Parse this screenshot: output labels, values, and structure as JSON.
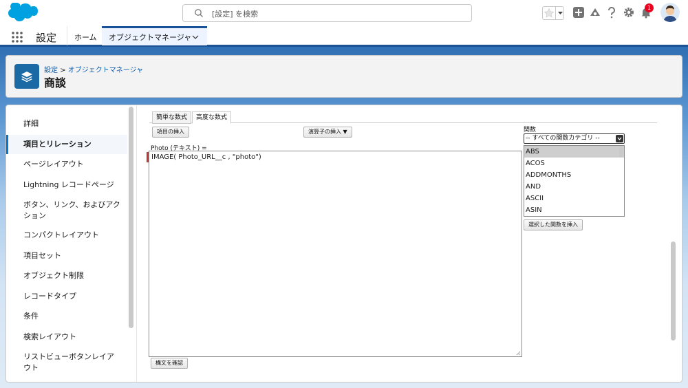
{
  "header": {
    "search_placeholder": "[設定] を検索",
    "notification_count": "1"
  },
  "context_bar": {
    "app_name": "設定",
    "tabs": [
      {
        "label": "ホーム"
      },
      {
        "label": "オブジェクトマネージャ"
      }
    ]
  },
  "page_header": {
    "breadcrumb": {
      "root": "設定",
      "separator": ">",
      "current": "オブジェクトマネージャ"
    },
    "title": "商談"
  },
  "sidebar": {
    "items": [
      {
        "label": "詳細"
      },
      {
        "label": "項目とリレーション"
      },
      {
        "label": "ページレイアウト"
      },
      {
        "label": "Lightning レコードページ"
      },
      {
        "label": "ボタン、リンク、およびアク"
      },
      {
        "label": "ション"
      },
      {
        "label": "コンパクトレイアウト"
      },
      {
        "label": "項目セット"
      },
      {
        "label": "オブジェクト制限"
      },
      {
        "label": "レコードタイプ"
      },
      {
        "label": "条件"
      },
      {
        "label": "検索レイアウト"
      },
      {
        "label": "リストビューボタンレイア"
      },
      {
        "label": "ウト"
      }
    ]
  },
  "editor": {
    "tabs": [
      {
        "label": "簡単な数式"
      },
      {
        "label": "高度な数式"
      }
    ],
    "insert_field_button": "項目の挿入",
    "insert_operator_button": "演算子の挿入",
    "field_label": "Photo (テキスト) =",
    "formula": "IMAGE( Photo_URL__c , \"photo\")",
    "check_syntax_button": "構文を確認"
  },
  "functions": {
    "label": "関数",
    "category": "-- すべての関数カテゴリ --",
    "items": [
      "ABS",
      "ACOS",
      "ADDMONTHS",
      "AND",
      "ASCII",
      "ASIN"
    ],
    "insert_button": "選択した関数を挿入"
  },
  "colors": {
    "brand": "#0176d3",
    "band": "#1b5297",
    "badge": "#ea001e"
  }
}
